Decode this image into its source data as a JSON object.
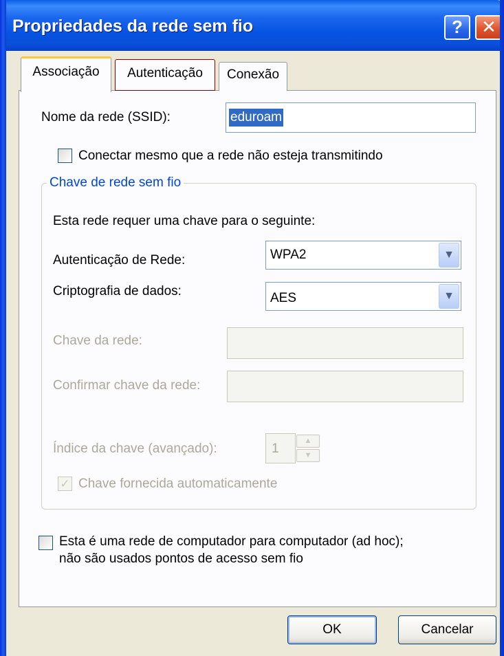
{
  "window": {
    "title": "Propriedades da rede sem fio",
    "help_glyph": "?",
    "close_glyph": "✕"
  },
  "tabs": [
    {
      "label": "Associação",
      "selected": true
    },
    {
      "label": "Autenticação",
      "selected": false
    },
    {
      "label": "Conexão",
      "selected": false
    }
  ],
  "association": {
    "ssid_label": "Nome da rede (SSID):",
    "ssid_value": "eduroam",
    "broadcast_checkbox_label": "Conectar mesmo que a rede não esteja transmitindo",
    "broadcast_checked": false,
    "group_title": "Chave de rede sem fio",
    "requirement_text": "Esta rede requer uma chave para o seguinte:",
    "auth_label": "Autenticação de Rede:",
    "auth_value": "WPA2",
    "encryption_label": "Criptografia de dados:",
    "encryption_value": "AES",
    "network_key_label": "Chave da rede:",
    "confirm_key_label": "Confirmar chave da rede:",
    "key_index_label": "Índice da chave (avançado):",
    "key_index_value": "1",
    "auto_key_label": "Chave fornecida automaticamente",
    "auto_key_checked": true,
    "adhoc_line1": "Esta é uma rede de computador para  computador (ad hoc);",
    "adhoc_line2": "não são usados pontos de acesso sem fio",
    "adhoc_checked": false
  },
  "buttons": {
    "ok": "OK",
    "cancel": "Cancelar"
  },
  "icons": {
    "dropdown": "chevron-down-icon",
    "spin_up": "spin-up-icon",
    "spin_down": "spin-down-icon",
    "check": "checkmark-icon"
  }
}
